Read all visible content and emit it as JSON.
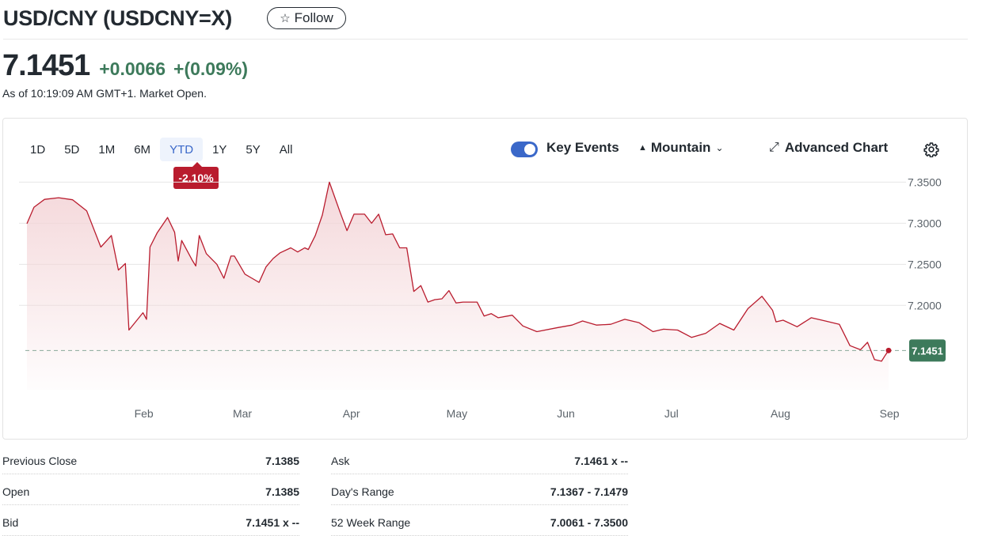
{
  "header": {
    "title": "USD/CNY (USDCNY=X)",
    "follow_label": "Follow"
  },
  "quote": {
    "price": "7.1451",
    "change": "+0.0066",
    "change_pct": "+(0.09%)",
    "as_of": "As of 10:19:09 AM GMT+1. Market Open.",
    "up_color": "#3d7a5b"
  },
  "chart_controls": {
    "ranges": [
      "1D",
      "5D",
      "1M",
      "6M",
      "YTD",
      "1Y",
      "5Y",
      "All"
    ],
    "active_range": "YTD",
    "range_change": "-2.10%",
    "key_events_label": "Key Events",
    "key_events_on": true,
    "chart_type_label": "Mountain",
    "advanced_label": "Advanced Chart",
    "icons": [
      "star-icon",
      "toggle-icon",
      "mountain-icon",
      "chevron-down-icon",
      "expand-icon",
      "gear-icon"
    ]
  },
  "chart_data": {
    "type": "area",
    "x_tick_labels": [
      "Feb",
      "Mar",
      "Apr",
      "May",
      "Jun",
      "Jul",
      "Aug",
      "Sep"
    ],
    "y_tick_labels": [
      "7.3500",
      "7.3000",
      "7.2500",
      "7.2000"
    ],
    "ylim": [
      7.105,
      7.36
    ],
    "x": [
      "2025-01-01",
      "2025-01-03",
      "2025-01-06",
      "2025-01-10",
      "2025-01-14",
      "2025-01-18",
      "2025-01-22",
      "2025-01-25",
      "2025-01-27",
      "2025-01-29",
      "2025-01-30",
      "2025-02-03",
      "2025-02-04",
      "2025-02-05",
      "2025-02-07",
      "2025-02-10",
      "2025-02-12",
      "2025-02-13",
      "2025-02-14",
      "2025-02-17",
      "2025-02-18",
      "2025-02-19",
      "2025-02-21",
      "2025-02-24",
      "2025-02-26",
      "2025-02-28",
      "2025-03-01",
      "2025-03-04",
      "2025-03-06",
      "2025-03-08",
      "2025-03-10",
      "2025-03-12",
      "2025-03-14",
      "2025-03-17",
      "2025-03-19",
      "2025-03-21",
      "2025-03-22",
      "2025-03-24",
      "2025-03-26",
      "2025-03-28",
      "2025-03-31",
      "2025-04-02",
      "2025-04-04",
      "2025-04-07",
      "2025-04-09",
      "2025-04-11",
      "2025-04-13",
      "2025-04-15",
      "2025-04-17",
      "2025-04-19",
      "2025-04-21",
      "2025-04-23",
      "2025-04-25",
      "2025-04-27",
      "2025-04-29",
      "2025-05-01",
      "2025-05-03",
      "2025-05-05",
      "2025-05-07",
      "2025-05-09",
      "2025-05-11",
      "2025-05-13",
      "2025-05-15",
      "2025-05-19",
      "2025-05-22",
      "2025-05-26",
      "2025-06-01",
      "2025-06-05",
      "2025-06-08",
      "2025-06-12",
      "2025-06-16",
      "2025-06-20",
      "2025-06-24",
      "2025-06-28",
      "2025-07-01",
      "2025-07-05",
      "2025-07-09",
      "2025-07-13",
      "2025-07-17",
      "2025-07-21",
      "2025-07-25",
      "2025-07-29",
      "2025-08-01",
      "2025-08-02",
      "2025-08-04",
      "2025-08-08",
      "2025-08-12",
      "2025-08-16",
      "2025-08-20",
      "2025-08-23",
      "2025-08-26",
      "2025-08-28",
      "2025-08-30",
      "2025-09-01",
      "2025-09-02",
      "2025-09-03"
    ],
    "values": [
      7.2995,
      7.3195,
      7.329,
      7.331,
      7.3285,
      7.315,
      7.271,
      7.285,
      7.243,
      7.251,
      7.17,
      7.191,
      7.183,
      7.271,
      7.288,
      7.307,
      7.289,
      7.254,
      7.279,
      7.255,
      7.248,
      7.285,
      7.263,
      7.25,
      7.233,
      7.26,
      7.26,
      7.238,
      7.233,
      7.228,
      7.247,
      7.257,
      7.264,
      7.27,
      7.265,
      7.27,
      7.268,
      7.285,
      7.31,
      7.35,
      7.314,
      7.291,
      7.311,
      7.311,
      7.3,
      7.311,
      7.286,
      7.287,
      7.27,
      7.27,
      7.217,
      7.224,
      7.204,
      7.207,
      7.208,
      7.218,
      7.203,
      7.204,
      7.204,
      7.204,
      7.187,
      7.19,
      7.185,
      7.188,
      7.175,
      7.168,
      7.173,
      7.176,
      7.181,
      7.176,
      7.177,
      7.183,
      7.179,
      7.168,
      7.171,
      7.17,
      7.161,
      7.166,
      7.178,
      7.17,
      7.196,
      7.211,
      7.194,
      7.18,
      7.182,
      7.174,
      7.185,
      7.181,
      7.177,
      7.151,
      7.146,
      7.155,
      7.134,
      7.132,
      7.139,
      7.1451
    ],
    "series": [
      {
        "name": "",
        "line_color": "#b91c2e",
        "fill_color": "#f3d3d6"
      }
    ],
    "reference_line": {
      "label": "7.1451",
      "value": 7.1451,
      "color": "#3d7a5b"
    },
    "grid": true
  },
  "stats": {
    "left": [
      {
        "label": "Previous Close",
        "value": "7.1385"
      },
      {
        "label": "Open",
        "value": "7.1385"
      },
      {
        "label": "Bid",
        "value": "7.1451 x --"
      }
    ],
    "right": [
      {
        "label": "Ask",
        "value": "7.1461 x --"
      },
      {
        "label": "Day's Range",
        "value": "7.1367 - 7.1479"
      },
      {
        "label": "52 Week Range",
        "value": "7.0061 - 7.3500"
      }
    ]
  }
}
